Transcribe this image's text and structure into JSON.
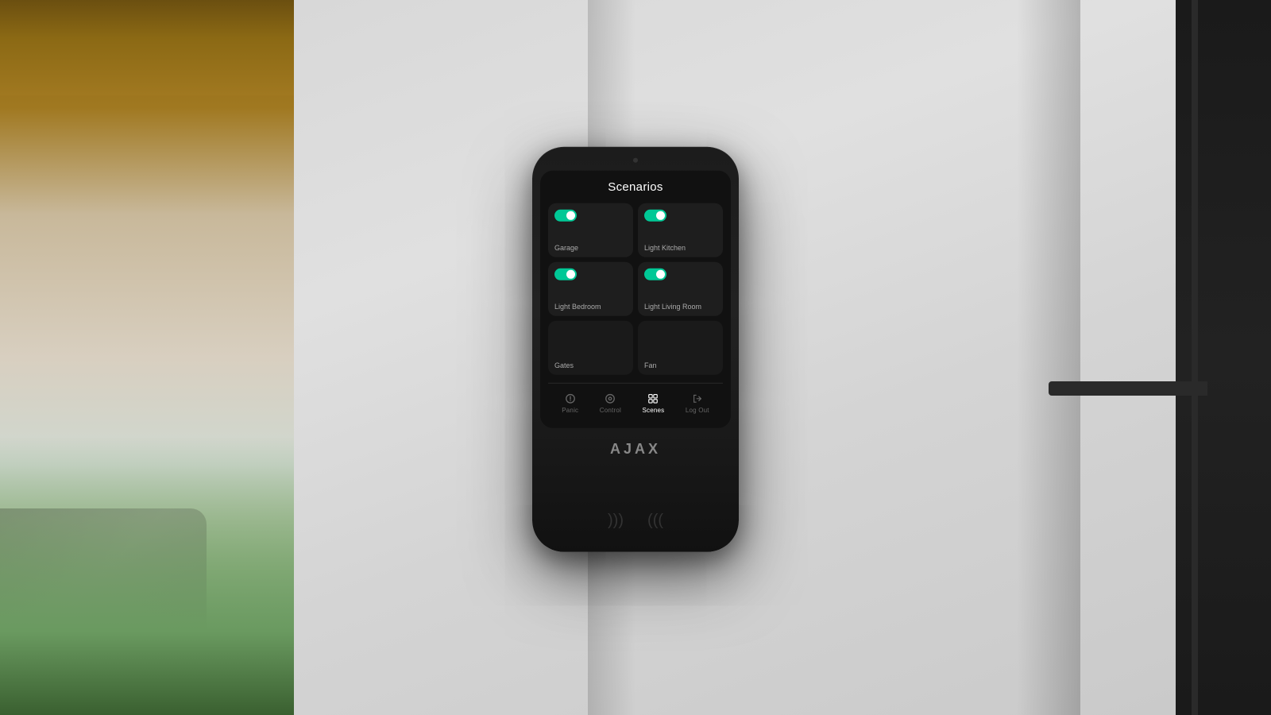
{
  "background": {
    "description": "Wall-mounted Ajax KeyPad touch device on light gray wall, with outdoor view on left side"
  },
  "device": {
    "brand": "AJAX",
    "screen": {
      "title": "Scenarios",
      "scenarios": [
        {
          "id": "garage",
          "label": "Garage",
          "toggle_state": "on",
          "row": 0,
          "col": 0
        },
        {
          "id": "light-kitchen",
          "label": "Light Kitchen",
          "toggle_state": "on",
          "row": 0,
          "col": 1
        },
        {
          "id": "light-bedroom",
          "label": "Light Bedroom",
          "toggle_state": "on",
          "row": 1,
          "col": 0
        },
        {
          "id": "light-living-room",
          "label": "Light Living Room",
          "toggle_state": "on",
          "row": 1,
          "col": 1
        },
        {
          "id": "gates",
          "label": "Gates",
          "toggle_state": "off",
          "row": 2,
          "col": 0
        },
        {
          "id": "fan",
          "label": "Fan",
          "toggle_state": "off",
          "row": 2,
          "col": 1
        }
      ]
    },
    "nav": {
      "items": [
        {
          "id": "panic",
          "label": "Panic",
          "icon": "panic",
          "active": false
        },
        {
          "id": "control",
          "label": "Control",
          "icon": "control",
          "active": false
        },
        {
          "id": "scenes",
          "label": "Scenes",
          "icon": "scenes",
          "active": true
        },
        {
          "id": "logout",
          "label": "Log Out",
          "icon": "logout",
          "active": false
        }
      ]
    }
  }
}
